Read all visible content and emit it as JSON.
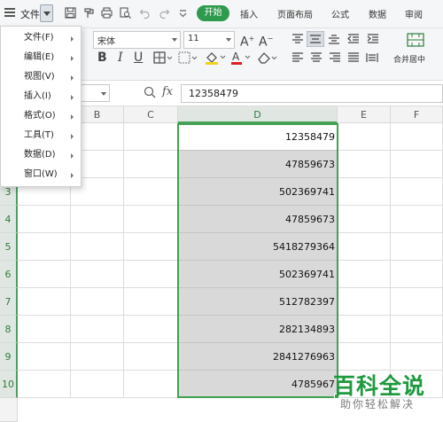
{
  "topbar": {
    "file_label": "文件",
    "tabs": [
      "开始",
      "插入",
      "页面布局",
      "公式",
      "数据",
      "审阅"
    ]
  },
  "ribbon": {
    "font_name": "宋体",
    "font_size": "11",
    "merge_center": "合并居中"
  },
  "formula_bar": {
    "fx": "fx",
    "value": "12358479"
  },
  "columns": [
    "B",
    "C",
    "D",
    "E",
    "F"
  ],
  "rows": [
    "3",
    "4",
    "5",
    "6",
    "7",
    "8",
    "9",
    "10"
  ],
  "cells_D": [
    "12358479",
    "47859673",
    "502369741",
    "47859673",
    "5418279364",
    "502369741",
    "512782397",
    "282134893",
    "2841276963",
    "4785967"
  ],
  "menu": {
    "items": [
      "文件(F)",
      "编辑(E)",
      "视图(V)",
      "插入(I)",
      "格式(O)",
      "工具(T)",
      "数据(D)",
      "窗口(W)"
    ]
  },
  "watermark": {
    "title": "百科全说",
    "subtitle": "助你轻松解决"
  },
  "colors": {
    "accent_green": "#2e9a4d",
    "selection_green": "#3ea24f"
  }
}
